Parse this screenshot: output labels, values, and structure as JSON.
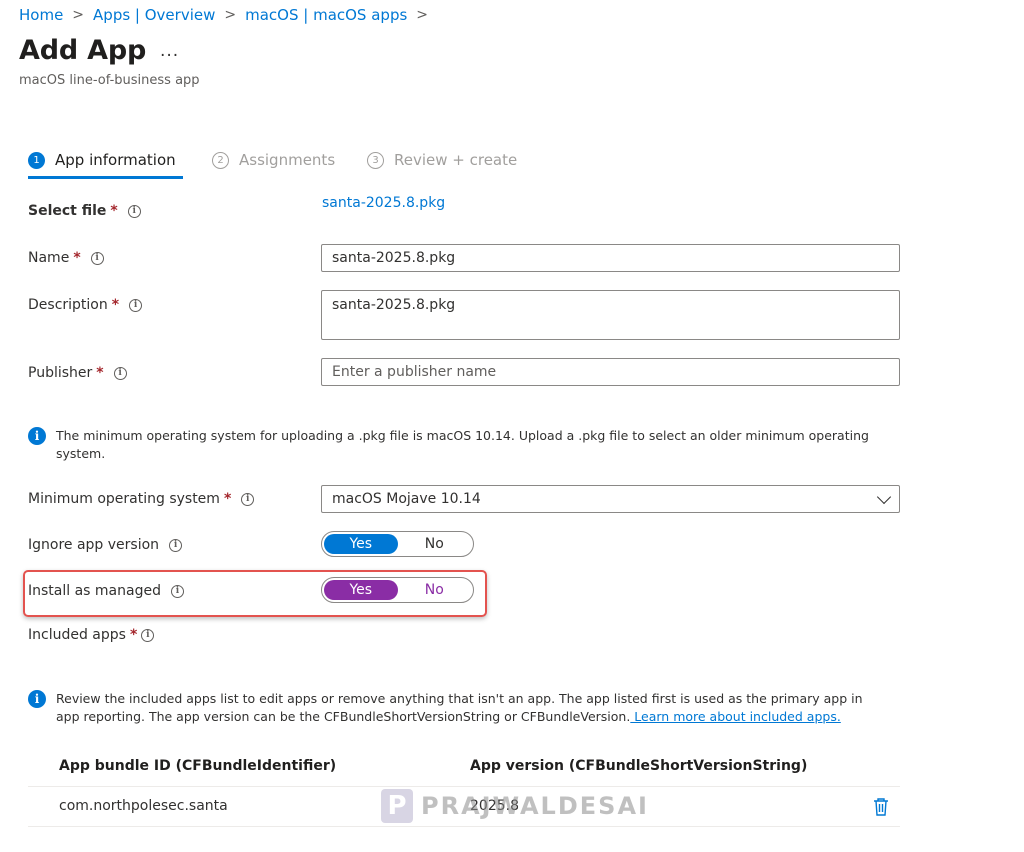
{
  "breadcrumb": [
    {
      "label": "Home"
    },
    {
      "label": "Apps | Overview"
    },
    {
      "label": "macOS | macOS apps"
    }
  ],
  "breadcrumb_separator": ">",
  "page": {
    "title": "Add App",
    "more": "...",
    "subtitle": "macOS line-of-business app"
  },
  "steps": [
    {
      "number": "1",
      "label": "App information",
      "active": true
    },
    {
      "number": "2",
      "label": "Assignments",
      "active": false
    },
    {
      "number": "3",
      "label": "Review + create",
      "active": false
    }
  ],
  "required_marker": "*",
  "info_glyph": "i",
  "form": {
    "select_file": {
      "label": "Select file",
      "value": "santa-2025.8.pkg"
    },
    "name": {
      "label": "Name",
      "value": "santa-2025.8.pkg"
    },
    "description": {
      "label": "Description",
      "value": "santa-2025.8.pkg"
    },
    "publisher": {
      "label": "Publisher",
      "value": "",
      "placeholder": "Enter a publisher name"
    },
    "os_info": "The minimum operating system for uploading a .pkg file is macOS 10.14. Upload a .pkg file to select an older minimum operating system.",
    "min_os": {
      "label": "Minimum operating system",
      "value": "macOS Mojave 10.14"
    },
    "ignore_version": {
      "label": "Ignore app version",
      "yes": "Yes",
      "no": "No",
      "selected": "Yes"
    },
    "install_managed": {
      "label": "Install as managed",
      "yes": "Yes",
      "no": "No",
      "selected": "Yes"
    },
    "included_apps": {
      "label": "Included apps"
    }
  },
  "included_info": {
    "text": "Review the included apps list to edit apps or remove anything that isn't an app. The app listed first is used as the primary app in app reporting. The app version can be the CFBundleShortVersionString or CFBundleVersion.",
    "link": " Learn more about included apps."
  },
  "table": {
    "headers": [
      "App bundle ID (CFBundleIdentifier)",
      "App version (CFBundleShortVersionString)"
    ],
    "rows": [
      {
        "bundle_id": "com.northpolesec.santa",
        "version": "2025.8"
      }
    ]
  },
  "watermark": {
    "logo": "P",
    "text": "PRAJWALDESAI"
  },
  "colors": {
    "accent": "#0078d4",
    "managed_toggle": "#8a2da5",
    "highlight": "#e3534f",
    "required": "#a4262c"
  },
  "icons": {
    "info": "info-icon",
    "delete": "trash-icon",
    "dropdown": "chevron-down-icon"
  }
}
